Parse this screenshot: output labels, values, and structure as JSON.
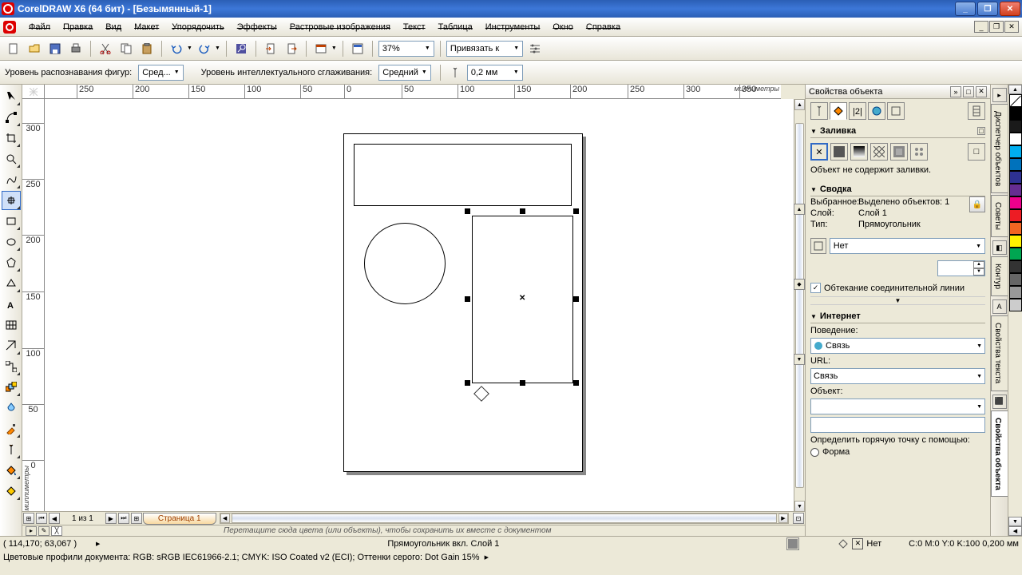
{
  "app": {
    "title": "CorelDRAW X6 (64 бит) - [Безымянный-1]"
  },
  "menu": {
    "file": "Файл",
    "edit": "Правка",
    "view": "Вид",
    "layout": "Макет",
    "arrange": "Упорядочить",
    "effects": "Эффекты",
    "bitmaps": "Растровые изображения",
    "text": "Текст",
    "table": "Таблица",
    "tools": "Инструменты",
    "window": "Окно",
    "help": "Справка"
  },
  "toolbar": {
    "zoom": "37%",
    "snap_label": "Привязать к"
  },
  "propbar": {
    "shape_recog_label": "Уровень распознавания фигур:",
    "shape_recog_value": "Сред...",
    "smooth_label": "Уровень интеллектуального сглаживания:",
    "smooth_value": "Средний",
    "outline_width": "0,2 мм"
  },
  "ruler": {
    "unit_h": "миллиметры",
    "unit_v": "миллиметры",
    "h_ticks": [
      "0",
      "50",
      "100",
      "150",
      "200",
      "250",
      "300",
      "350"
    ],
    "h_neg": [
      "50",
      "100",
      "150",
      "200",
      "250"
    ],
    "v_ticks": [
      "300",
      "250",
      "200",
      "150",
      "100",
      "50",
      "0"
    ]
  },
  "pages": {
    "counter": "1 из 1",
    "tab": "Страница 1"
  },
  "color_tray": {
    "hint": "Перетащите сюда цвета (или объекты), чтобы сохранить их вместе с документом"
  },
  "docker": {
    "title": "Свойства объекта",
    "fill": {
      "header": "Заливка",
      "no_fill_msg": "Объект не содержит заливки."
    },
    "summary": {
      "header": "Сводка",
      "selected_label": "Выбранное:",
      "selected_value": "Выделено объектов: 1",
      "layer_label": "Слой:",
      "layer_value": "Слой 1",
      "type_label": "Тип:",
      "type_value": "Прямоугольник",
      "wrap_none": "Нет",
      "wrap_check": "Обтекание соединительной линии"
    },
    "internet": {
      "header": "Интернет",
      "behavior_label": "Поведение:",
      "behavior_value": "Связь",
      "url_label": "URL:",
      "url_value": "Связь",
      "object_label": "Объект:",
      "hotspot_label": "Определить горячую точку с помощью:",
      "shape_radio": "Форма"
    }
  },
  "side_tabs": {
    "obj_manager": "Диспетчер объектов",
    "hints": "Советы",
    "outline": "Контур",
    "text_props": "Свойства текста",
    "obj_props": "Свойства объекта"
  },
  "palette_colors": [
    "#000000",
    "#1a1a1a",
    "#ffffff",
    "#00aeef",
    "#0072bc",
    "#2e3192",
    "#662d91",
    "#ec008c",
    "#ed1c24",
    "#f26522",
    "#fff200",
    "#00a651",
    "#333333",
    "#666666",
    "#999999",
    "#cccccc"
  ],
  "status": {
    "coord": "( 114,170; 63,067 )",
    "selection": "Прямоугольник вкл. Слой 1",
    "fill_label": "Нет",
    "outline_info": "C:0 M:0 Y:0 K:100  0,200 мм",
    "profiles": "Цветовые профили документа: RGB: sRGB IEC61966-2.1; CMYK: ISO Coated v2 (ECI); Оттенки серого: Dot Gain 15%"
  }
}
